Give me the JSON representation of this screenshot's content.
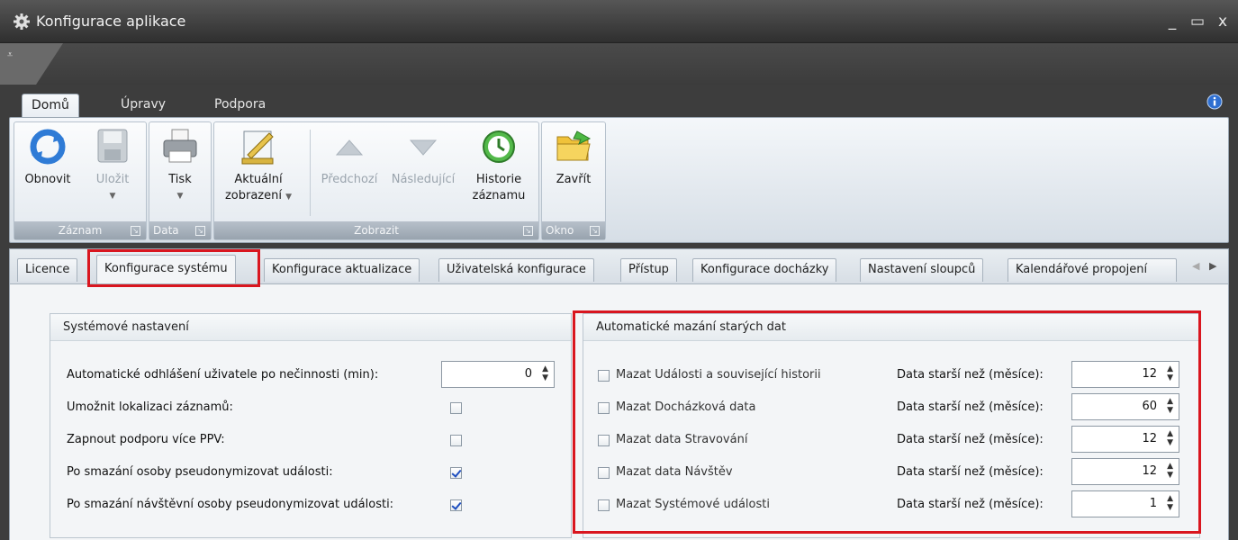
{
  "window": {
    "title": "Konfigurace aplikace",
    "controls": {
      "minimize": "_",
      "maximize": "▭",
      "close": "x"
    }
  },
  "ribbon": {
    "tabs": [
      "Domů",
      "Úpravy",
      "Podpora"
    ],
    "active_tab": "Domů",
    "groups": [
      {
        "caption": "Záznam",
        "buttons": [
          {
            "label": "Obnovit",
            "icon": "refresh-icon"
          },
          {
            "label": "Uložit",
            "icon": "save-icon",
            "disabled": true,
            "dropdown": true
          }
        ]
      },
      {
        "caption": "Data",
        "buttons": [
          {
            "label": "Tisk",
            "icon": "printer-icon",
            "dropdown": true
          }
        ]
      },
      {
        "caption": "Zobrazit",
        "buttons": [
          {
            "label": "Aktuální",
            "label2": "zobrazení",
            "icon": "edit-view-icon",
            "dropdown": true
          },
          {
            "label": "Předchozí",
            "icon": "arrow-up-icon",
            "disabled": true
          },
          {
            "label": "Následující",
            "icon": "arrow-down-icon",
            "disabled": true
          },
          {
            "label": "Historie",
            "label2": "záznamu",
            "icon": "history-clock-icon"
          }
        ]
      },
      {
        "caption": "Okno",
        "buttons": [
          {
            "label": "Zavřít",
            "icon": "folder-close-icon"
          }
        ]
      }
    ]
  },
  "page_tabs": [
    "Licence",
    "Konfigurace systému",
    "Konfigurace aktualizace",
    "Uživatelská konfigurace",
    "Přístup",
    "Konfigurace docházky",
    "Nastavení sloupců",
    "Kalendářové propojení"
  ],
  "active_page_tab": "Konfigurace systému",
  "system_settings": {
    "title": "Systémové nastavení",
    "rows": [
      {
        "label": "Automatické odhlášení uživatele po nečinnosti (min):",
        "type": "spin",
        "value": "0"
      },
      {
        "label": "Umožnit lokalizaci záznamů:",
        "type": "checkbox",
        "checked": false
      },
      {
        "label": "Zapnout podporu více PPV:",
        "type": "checkbox",
        "checked": false
      },
      {
        "label": "Po smazání osoby pseudonymizovat události:",
        "type": "checkbox",
        "checked": true
      },
      {
        "label": "Po smazání návštěvní osoby pseudonymizovat události:",
        "type": "checkbox",
        "checked": true
      }
    ]
  },
  "auto_delete": {
    "title": "Automatické mazání starých dat",
    "age_label": "Data starší než (měsíce):",
    "rows": [
      {
        "label": "Mazat Události a související historii",
        "checked": false,
        "months": "12"
      },
      {
        "label": "Mazat Docházková data",
        "checked": false,
        "months": "60"
      },
      {
        "label": "Mazat data Stravování",
        "checked": false,
        "months": "12"
      },
      {
        "label": "Mazat data Návštěv",
        "checked": false,
        "months": "12"
      },
      {
        "label": "Mazat Systémové události",
        "checked": false,
        "months": "1"
      }
    ]
  },
  "colors": {
    "highlight": "#d9161f",
    "ribbon_bg": "#e3e9ef",
    "title_bar": "#3d3d3d"
  }
}
